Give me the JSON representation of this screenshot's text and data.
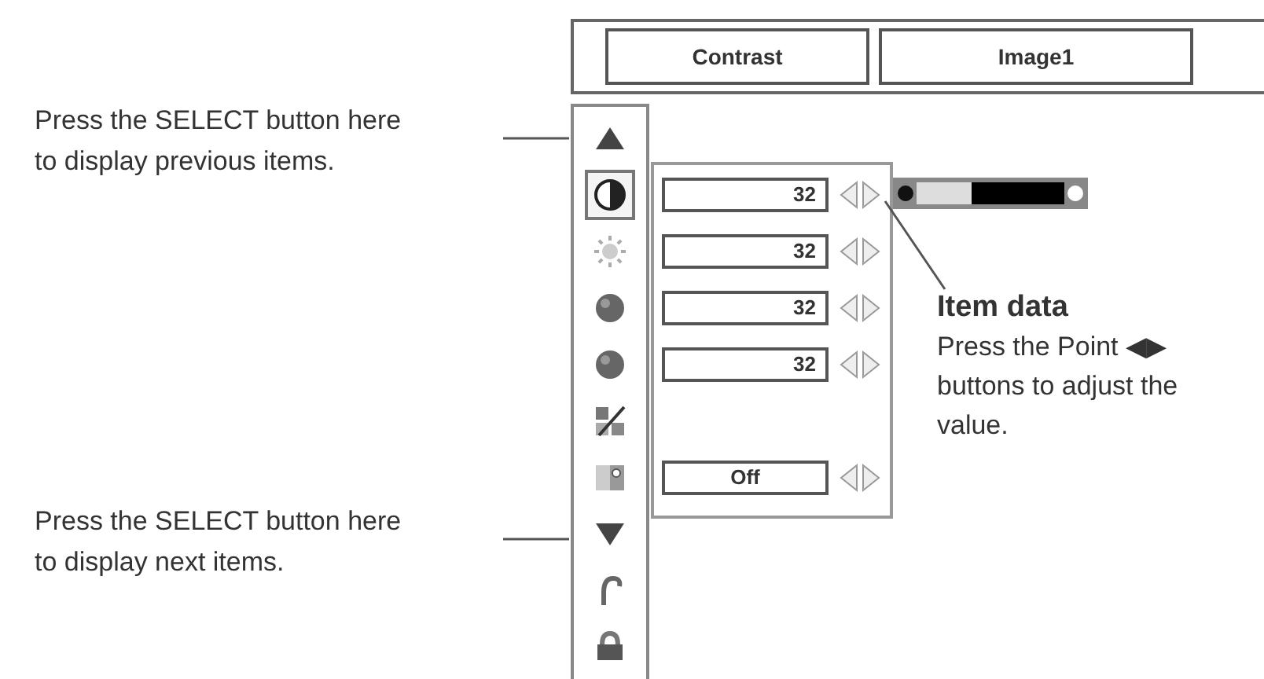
{
  "header": {
    "item": "Contrast",
    "mode": "Image1"
  },
  "menu": [
    {
      "kind": "up",
      "selected": false
    },
    {
      "kind": "contrast",
      "selected": true,
      "value": "32",
      "level": 0.37
    },
    {
      "kind": "brightness",
      "selected": false,
      "value": "32"
    },
    {
      "kind": "sphere",
      "selected": false,
      "value": "32"
    },
    {
      "kind": "sphere",
      "selected": false,
      "value": "32"
    },
    {
      "kind": "chart",
      "selected": false
    },
    {
      "kind": "image",
      "selected": false,
      "value": "Off"
    },
    {
      "kind": "down",
      "selected": false
    },
    {
      "kind": "hook",
      "selected": false
    },
    {
      "kind": "bag",
      "selected": false
    }
  ],
  "callouts": [
    {
      "text": "Press the SELECT button here\nto display previous items."
    },
    {
      "text": "Press the SELECT button here\nto display next items."
    }
  ],
  "item_data": {
    "title": "Item data",
    "text": "Press the Point ◀▶\nbuttons to adjust the\nvalue."
  }
}
